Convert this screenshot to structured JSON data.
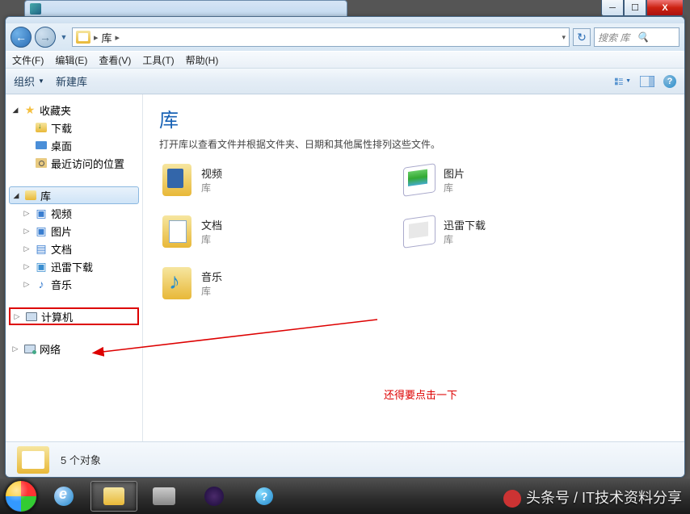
{
  "titlebar": {
    "min": "─",
    "max": "☐",
    "close": "X"
  },
  "nav": {
    "address_root_label": "库",
    "search_placeholder": "搜索 库"
  },
  "menubar": {
    "file": "文件(F)",
    "edit": "编辑(E)",
    "view": "查看(V)",
    "tools": "工具(T)",
    "help": "帮助(H)"
  },
  "toolbar": {
    "organize": "组织",
    "new_library": "新建库"
  },
  "sidebar": {
    "favorites": {
      "label": "收藏夹",
      "items": [
        {
          "label": "下载"
        },
        {
          "label": "桌面"
        },
        {
          "label": "最近访问的位置"
        }
      ]
    },
    "libraries": {
      "label": "库",
      "items": [
        {
          "label": "视频"
        },
        {
          "label": "图片"
        },
        {
          "label": "文档"
        },
        {
          "label": "迅雷下载"
        },
        {
          "label": "音乐"
        }
      ]
    },
    "computer": {
      "label": "计算机"
    },
    "network": {
      "label": "网络"
    }
  },
  "content": {
    "title": "库",
    "subtitle": "打开库以查看文件并根据文件夹、日期和其他属性排列这些文件。",
    "type_label": "库",
    "items": [
      {
        "name": "视频"
      },
      {
        "name": "图片"
      },
      {
        "name": "文档"
      },
      {
        "name": "迅雷下载"
      },
      {
        "name": "音乐"
      }
    ]
  },
  "annotation": {
    "text": "还得要点击一下"
  },
  "statusbar": {
    "text": "5 个对象"
  },
  "watermark": "头条号 / IT技术资料分享"
}
